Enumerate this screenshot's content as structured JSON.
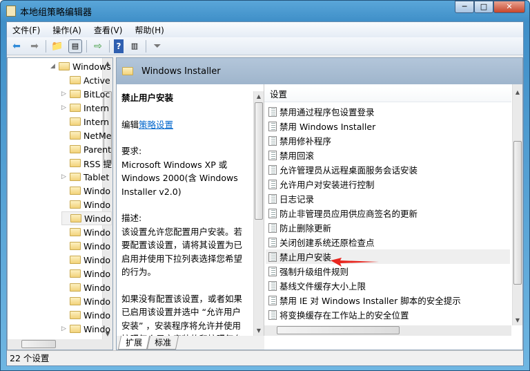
{
  "window": {
    "title": "本地组策略编辑器",
    "minimize": "─",
    "maximize": "□",
    "close": "✕"
  },
  "menu": [
    "文件(F)",
    "操作(A)",
    "查看(V)",
    "帮助(H)"
  ],
  "tree": {
    "items": [
      {
        "label": "Windows",
        "exp": "◢"
      },
      {
        "label": "Active",
        "exp": ""
      },
      {
        "label": "BitLoc",
        "exp": "▷"
      },
      {
        "label": "Intern",
        "exp": "▷"
      },
      {
        "label": "Intern",
        "exp": ""
      },
      {
        "label": "NetMe",
        "exp": ""
      },
      {
        "label": "Parent",
        "exp": ""
      },
      {
        "label": "RSS 提",
        "exp": ""
      },
      {
        "label": "Tablet",
        "exp": "▷"
      },
      {
        "label": "Windo",
        "exp": ""
      },
      {
        "label": "Windo",
        "exp": ""
      },
      {
        "label": "Windo",
        "exp": ""
      },
      {
        "label": "Windo",
        "exp": ""
      },
      {
        "label": "Windo",
        "exp": ""
      },
      {
        "label": "Windo",
        "exp": ""
      },
      {
        "label": "Windo",
        "exp": ""
      },
      {
        "label": "Windo",
        "exp": ""
      },
      {
        "label": "Windo",
        "exp": ""
      },
      {
        "label": "Windo",
        "exp": ""
      },
      {
        "label": "Windo",
        "exp": "▷"
      }
    ],
    "selected_index": 11
  },
  "header": {
    "title": "Windows Installer"
  },
  "description": {
    "title": "禁止用户安装",
    "edit_prefix": "编辑",
    "edit_link": "策略设置",
    "req_label": "要求:",
    "req_text": "Microsoft Windows XP 或 Windows 2000(含 Windows Installer v2.0)",
    "desc_label": "描述:",
    "desc_p1": "该设置允许您配置用户安装。若要配置该设置，请将其设置为已启用并使用下拉列表选择您希望的行为。",
    "desc_p2": "如果没有配置该设置，或者如果已启用该设置并选中 “允许用户安装” ，安装程序将允许并使用按照每个用户安装的和按照每台计算机"
  },
  "list": {
    "column": "设置",
    "items": [
      "禁用通过程序包设置登录",
      "禁用 Windows Installer",
      "禁用修补程序",
      "禁用回滚",
      "允许管理员从远程桌面服务会话安装",
      "允许用户对安装进行控制",
      "日志记录",
      "防止非管理员应用供应商签名的更新",
      "防止删除更新",
      "关闭创建系统还原检查点",
      "禁止用户安装",
      "强制升级组件规则",
      "基线文件缓存大小上限",
      "禁用 IE 对 Windows Installer 脚本的安全提示",
      "将变换缓存在工作站上的安全位置"
    ],
    "selected_index": 10
  },
  "tabs": [
    "扩展",
    "标准"
  ],
  "status": "22 个设置",
  "colors": {
    "annotation_arrow": "#e8251e",
    "header_band": "#a9bdd2",
    "link": "#0066cc"
  }
}
